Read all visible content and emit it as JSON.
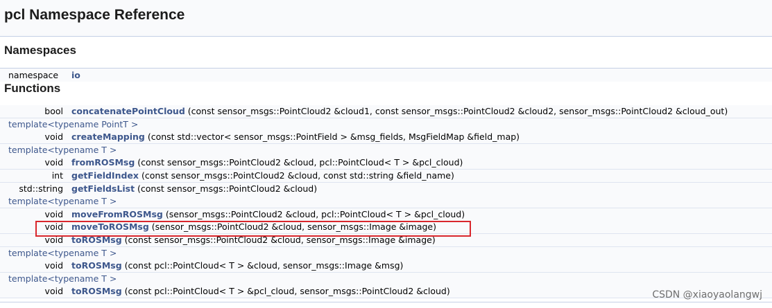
{
  "page": {
    "title": "pcl Namespace Reference"
  },
  "namespaces": {
    "heading": "Namespaces",
    "items": [
      {
        "kind": "namespace",
        "name": "io"
      }
    ]
  },
  "functions": {
    "heading": "Functions",
    "rows": [
      {
        "type": "member",
        "return_type": "bool",
        "name": "concatenatePointCloud",
        "args": " (const sensor_msgs::PointCloud2 &cloud1, const sensor_msgs::PointCloud2 &cloud2, sensor_msgs::PointCloud2 &cloud_out)"
      },
      {
        "type": "template",
        "text": "template<typename PointT >"
      },
      {
        "type": "member",
        "return_type": "void",
        "name": "createMapping",
        "args": " (const std::vector< sensor_msgs::PointField > &msg_fields, MsgFieldMap &field_map)"
      },
      {
        "type": "template",
        "text": "template<typename T >"
      },
      {
        "type": "member",
        "return_type": "void",
        "name": "fromROSMsg",
        "args": " (const sensor_msgs::PointCloud2 &cloud, pcl::PointCloud< T > &pcl_cloud)"
      },
      {
        "type": "member",
        "return_type": "int",
        "name": "getFieldIndex",
        "args": " (const sensor_msgs::PointCloud2 &cloud, const std::string &field_name)"
      },
      {
        "type": "member",
        "return_type": "std::string",
        "name": "getFieldsList",
        "args": " (const sensor_msgs::PointCloud2 &cloud)"
      },
      {
        "type": "template",
        "text": "template<typename T >"
      },
      {
        "type": "member",
        "return_type": "void",
        "name": "moveFromROSMsg",
        "args": " (sensor_msgs::PointCloud2 &cloud, pcl::PointCloud< T > &pcl_cloud)"
      },
      {
        "type": "member",
        "return_type": "void",
        "name": "moveToROSMsg",
        "args": " (sensor_msgs::PointCloud2 &cloud, sensor_msgs::Image &image)",
        "highlighted": true
      },
      {
        "type": "member",
        "return_type": "void",
        "name": "toROSMsg",
        "args": " (const sensor_msgs::PointCloud2 &cloud, sensor_msgs::Image &image)"
      },
      {
        "type": "template",
        "text": "template<typename T >"
      },
      {
        "type": "member",
        "return_type": "void",
        "name": "toROSMsg",
        "args": " (const pcl::PointCloud< T > &cloud, sensor_msgs::Image &msg)"
      },
      {
        "type": "template",
        "text": "template<typename T >"
      },
      {
        "type": "member",
        "return_type": "void",
        "name": "toROSMsg",
        "args": " (const pcl::PointCloud< T > &pcl_cloud, sensor_msgs::PointCloud2 &cloud)"
      }
    ]
  },
  "watermark": "CSDN @xiaoyaolangwj",
  "colors": {
    "link": "#3d578c",
    "header_bg": "#f9fafc",
    "rule": "#c4cfe5",
    "highlight_box": "#d9262c"
  }
}
